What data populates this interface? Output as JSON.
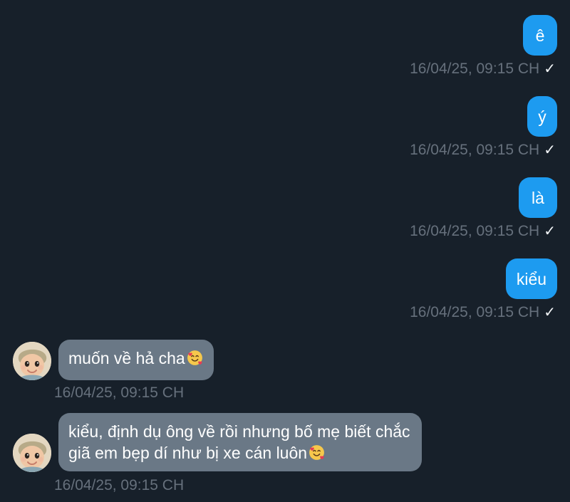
{
  "messages": [
    {
      "direction": "outgoing",
      "text": "ê",
      "timestamp": "16/04/25, 09:15 CH",
      "status": "✓"
    },
    {
      "direction": "outgoing",
      "text": "ý",
      "timestamp": "16/04/25, 09:15 CH",
      "status": "✓"
    },
    {
      "direction": "outgoing",
      "text": "là",
      "timestamp": "16/04/25, 09:15 CH",
      "status": "✓"
    },
    {
      "direction": "outgoing",
      "text": "kiểu",
      "timestamp": "16/04/25, 09:15 CH",
      "status": "✓"
    },
    {
      "direction": "incoming",
      "text": "muốn về hả cha",
      "emoji": "smiling-face-with-hearts-icon",
      "timestamp": "16/04/25, 09:15 CH"
    },
    {
      "direction": "incoming",
      "text": "kiểu, định dụ ông về rồi nhưng bố mẹ biết chắc",
      "text_line2": "giã em bẹp dí như bị xe cán luôn",
      "emoji": "smiling-face-with-hearts-icon",
      "timestamp": "16/04/25, 09:15 CH"
    }
  ],
  "avatar": {
    "icon": "baby-avatar-icon"
  },
  "colors": {
    "background": "#17202a",
    "outgoing_bubble": "#1d9bf0",
    "incoming_bubble": "#6a7886",
    "timestamp": "#66707c"
  }
}
